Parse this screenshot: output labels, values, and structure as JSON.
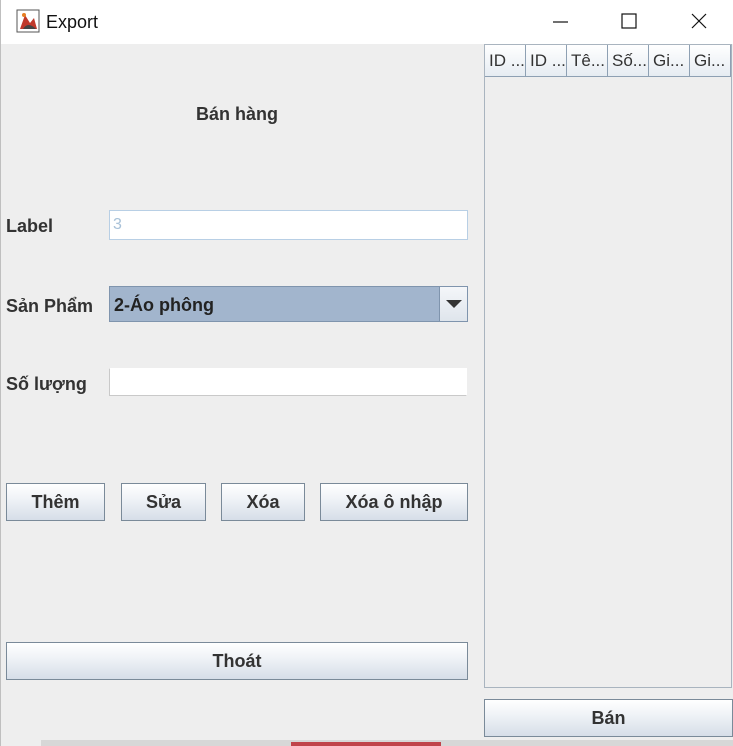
{
  "window": {
    "title": "Export"
  },
  "form": {
    "heading": "Bán hàng",
    "label_field": {
      "label": "Label",
      "value": "3"
    },
    "product_field": {
      "label": "Sản Phẩm",
      "selected": "2-Áo phông"
    },
    "quantity_field": {
      "label": "Số lượng",
      "value": ""
    }
  },
  "buttons": {
    "add": "Thêm",
    "edit": "Sửa",
    "delete": "Xóa",
    "clear": "Xóa ô nhập",
    "exit": "Thoát",
    "sell": "Bán"
  },
  "table": {
    "columns": [
      "ID ...",
      "ID ...",
      "Tê...",
      "Số...",
      "Gi...",
      "Gi..."
    ],
    "rows": []
  },
  "icons": {
    "app": "java-cup-icon",
    "minimize": "minimize-icon",
    "maximize": "maximize-icon",
    "close": "close-icon",
    "dropdown": "triangle-down-icon"
  }
}
